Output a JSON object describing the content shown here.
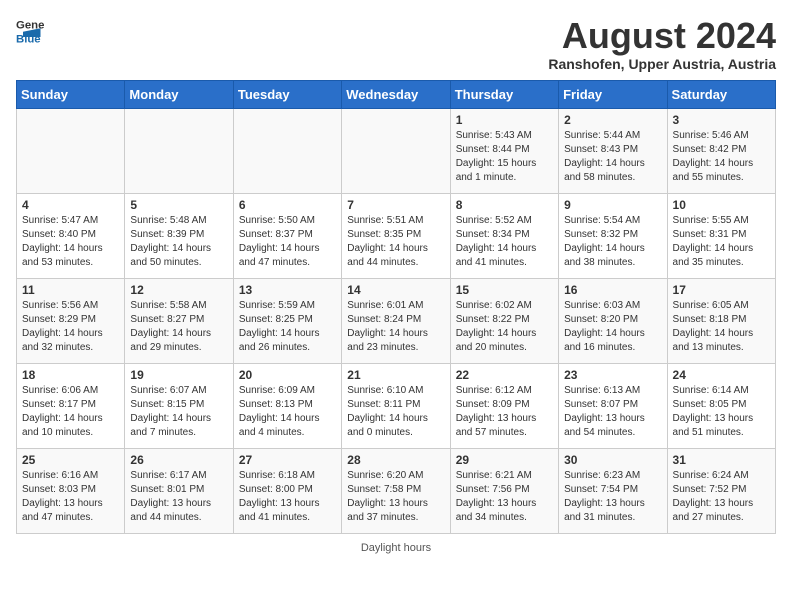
{
  "header": {
    "logo_general": "General",
    "logo_blue": "Blue",
    "month_year": "August 2024",
    "location": "Ranshofen, Upper Austria, Austria"
  },
  "days_of_week": [
    "Sunday",
    "Monday",
    "Tuesday",
    "Wednesday",
    "Thursday",
    "Friday",
    "Saturday"
  ],
  "weeks": [
    [
      {
        "day": "",
        "info": ""
      },
      {
        "day": "",
        "info": ""
      },
      {
        "day": "",
        "info": ""
      },
      {
        "day": "",
        "info": ""
      },
      {
        "day": "1",
        "info": "Sunrise: 5:43 AM\nSunset: 8:44 PM\nDaylight: 15 hours\nand 1 minute."
      },
      {
        "day": "2",
        "info": "Sunrise: 5:44 AM\nSunset: 8:43 PM\nDaylight: 14 hours\nand 58 minutes."
      },
      {
        "day": "3",
        "info": "Sunrise: 5:46 AM\nSunset: 8:42 PM\nDaylight: 14 hours\nand 55 minutes."
      }
    ],
    [
      {
        "day": "4",
        "info": "Sunrise: 5:47 AM\nSunset: 8:40 PM\nDaylight: 14 hours\nand 53 minutes."
      },
      {
        "day": "5",
        "info": "Sunrise: 5:48 AM\nSunset: 8:39 PM\nDaylight: 14 hours\nand 50 minutes."
      },
      {
        "day": "6",
        "info": "Sunrise: 5:50 AM\nSunset: 8:37 PM\nDaylight: 14 hours\nand 47 minutes."
      },
      {
        "day": "7",
        "info": "Sunrise: 5:51 AM\nSunset: 8:35 PM\nDaylight: 14 hours\nand 44 minutes."
      },
      {
        "day": "8",
        "info": "Sunrise: 5:52 AM\nSunset: 8:34 PM\nDaylight: 14 hours\nand 41 minutes."
      },
      {
        "day": "9",
        "info": "Sunrise: 5:54 AM\nSunset: 8:32 PM\nDaylight: 14 hours\nand 38 minutes."
      },
      {
        "day": "10",
        "info": "Sunrise: 5:55 AM\nSunset: 8:31 PM\nDaylight: 14 hours\nand 35 minutes."
      }
    ],
    [
      {
        "day": "11",
        "info": "Sunrise: 5:56 AM\nSunset: 8:29 PM\nDaylight: 14 hours\nand 32 minutes."
      },
      {
        "day": "12",
        "info": "Sunrise: 5:58 AM\nSunset: 8:27 PM\nDaylight: 14 hours\nand 29 minutes."
      },
      {
        "day": "13",
        "info": "Sunrise: 5:59 AM\nSunset: 8:25 PM\nDaylight: 14 hours\nand 26 minutes."
      },
      {
        "day": "14",
        "info": "Sunrise: 6:01 AM\nSunset: 8:24 PM\nDaylight: 14 hours\nand 23 minutes."
      },
      {
        "day": "15",
        "info": "Sunrise: 6:02 AM\nSunset: 8:22 PM\nDaylight: 14 hours\nand 20 minutes."
      },
      {
        "day": "16",
        "info": "Sunrise: 6:03 AM\nSunset: 8:20 PM\nDaylight: 14 hours\nand 16 minutes."
      },
      {
        "day": "17",
        "info": "Sunrise: 6:05 AM\nSunset: 8:18 PM\nDaylight: 14 hours\nand 13 minutes."
      }
    ],
    [
      {
        "day": "18",
        "info": "Sunrise: 6:06 AM\nSunset: 8:17 PM\nDaylight: 14 hours\nand 10 minutes."
      },
      {
        "day": "19",
        "info": "Sunrise: 6:07 AM\nSunset: 8:15 PM\nDaylight: 14 hours\nand 7 minutes."
      },
      {
        "day": "20",
        "info": "Sunrise: 6:09 AM\nSunset: 8:13 PM\nDaylight: 14 hours\nand 4 minutes."
      },
      {
        "day": "21",
        "info": "Sunrise: 6:10 AM\nSunset: 8:11 PM\nDaylight: 14 hours\nand 0 minutes."
      },
      {
        "day": "22",
        "info": "Sunrise: 6:12 AM\nSunset: 8:09 PM\nDaylight: 13 hours\nand 57 minutes."
      },
      {
        "day": "23",
        "info": "Sunrise: 6:13 AM\nSunset: 8:07 PM\nDaylight: 13 hours\nand 54 minutes."
      },
      {
        "day": "24",
        "info": "Sunrise: 6:14 AM\nSunset: 8:05 PM\nDaylight: 13 hours\nand 51 minutes."
      }
    ],
    [
      {
        "day": "25",
        "info": "Sunrise: 6:16 AM\nSunset: 8:03 PM\nDaylight: 13 hours\nand 47 minutes."
      },
      {
        "day": "26",
        "info": "Sunrise: 6:17 AM\nSunset: 8:01 PM\nDaylight: 13 hours\nand 44 minutes."
      },
      {
        "day": "27",
        "info": "Sunrise: 6:18 AM\nSunset: 8:00 PM\nDaylight: 13 hours\nand 41 minutes."
      },
      {
        "day": "28",
        "info": "Sunrise: 6:20 AM\nSunset: 7:58 PM\nDaylight: 13 hours\nand 37 minutes."
      },
      {
        "day": "29",
        "info": "Sunrise: 6:21 AM\nSunset: 7:56 PM\nDaylight: 13 hours\nand 34 minutes."
      },
      {
        "day": "30",
        "info": "Sunrise: 6:23 AM\nSunset: 7:54 PM\nDaylight: 13 hours\nand 31 minutes."
      },
      {
        "day": "31",
        "info": "Sunrise: 6:24 AM\nSunset: 7:52 PM\nDaylight: 13 hours\nand 27 minutes."
      }
    ]
  ],
  "footer": {
    "note": "Daylight hours"
  }
}
